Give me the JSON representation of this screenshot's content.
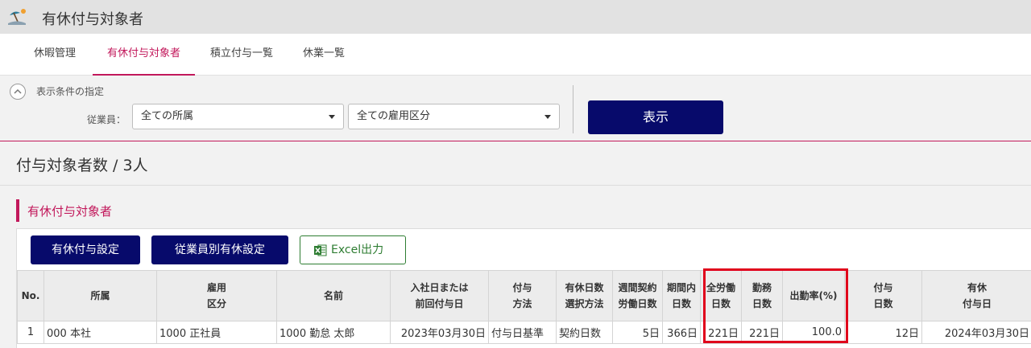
{
  "app": {
    "title": "有休付与対象者",
    "icon": "beach-umbrella-icon"
  },
  "tabs": [
    {
      "label": "休暇管理",
      "active": false
    },
    {
      "label": "有休付与対象者",
      "active": true
    },
    {
      "label": "積立付与一覧",
      "active": false
    },
    {
      "label": "休業一覧",
      "active": false
    }
  ],
  "conditions": {
    "title": "表示条件の指定",
    "employee_label": "従業員：",
    "dept_select": "全ての所属",
    "employment_select": "全ての雇用区分",
    "show_button": "表示"
  },
  "summary": {
    "count_text": "付与対象者数 / 3人"
  },
  "section": {
    "title": "有休付与対象者",
    "buttons": {
      "settings": "有休付与設定",
      "per_employee": "従業員別有休設定",
      "excel": "Excel出力"
    }
  },
  "table": {
    "headers": [
      "No.",
      "所属",
      "雇用\n区分",
      "名前",
      "入社日または\n前回付与日",
      "付与\n方法",
      "有休日数\n選択方法",
      "週間契約\n労働日数",
      "期間内\n日数",
      "全労働\n日数",
      "勤務\n日数",
      "出勤率(%)",
      "付与\n日数",
      "有休\n付与日"
    ],
    "rows": [
      [
        "1",
        "000 本社",
        "1000 正社員",
        "1000 勤怠 太郎",
        "2023年03月30日",
        "付与日基準",
        "契約日数",
        "5日",
        "366日",
        "221日",
        "221日",
        "100.0",
        "12日",
        "2024年03月30日"
      ]
    ]
  },
  "colors": {
    "accent": "#c2185b",
    "primary": "#070a6b",
    "excel": "#2e7d32",
    "highlight": "#e0001b"
  }
}
